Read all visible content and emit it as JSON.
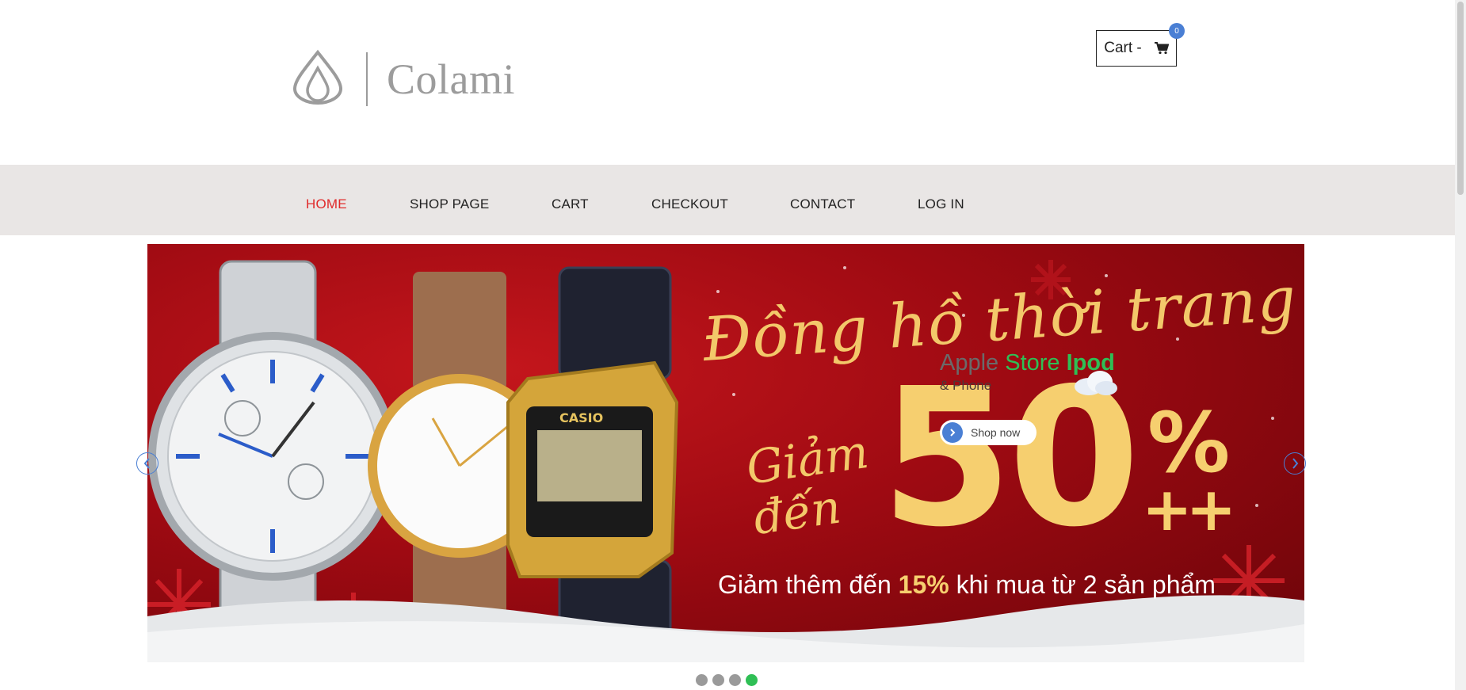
{
  "header": {
    "logo_text": "Colami",
    "cart_label": "Cart -",
    "cart_count": "0"
  },
  "nav": {
    "items": [
      {
        "label": "HOME",
        "active": true
      },
      {
        "label": "SHOP PAGE",
        "active": false
      },
      {
        "label": "CART",
        "active": false
      },
      {
        "label": "CHECKOUT",
        "active": false
      },
      {
        "label": "CONTACT",
        "active": false
      },
      {
        "label": "LOG IN",
        "active": false
      }
    ]
  },
  "banner": {
    "title": "Đồng hồ thời trang",
    "discount_prefix_line1": "Giảm",
    "discount_prefix_line2": "đến",
    "discount_value": "50",
    "percent_sign": "%",
    "plus_signs": "++",
    "subline_pre": "Giảm thêm đến",
    "subline_highlight": "15%",
    "subline_post": "khi mua từ 2 sản phẩm",
    "overlay": {
      "apple": "Apple",
      "store": "Store",
      "ipod": "Ipod",
      "subtitle": "& Phone",
      "button_label": "Shop now"
    }
  },
  "slider": {
    "dot_count": 4,
    "active_index": 3
  },
  "colors": {
    "accent_red": "#e02a2a",
    "accent_green": "#2fbf55",
    "accent_blue": "#4a7fd4",
    "nav_bg": "#e9e6e5"
  }
}
